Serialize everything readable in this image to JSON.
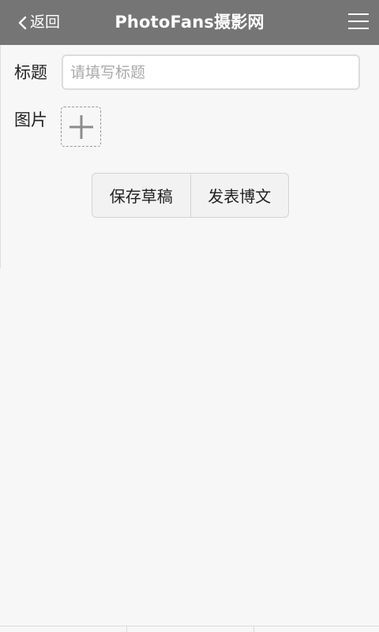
{
  "header": {
    "back_label": "返回",
    "title": "PhotoFans摄影网",
    "background_color": "#757575"
  },
  "form": {
    "title_label": "标题",
    "title_value": "",
    "title_placeholder": "请填写标题",
    "image_label": "图片"
  },
  "actions": {
    "save_draft_label": "保存草稿",
    "publish_label": "发表博文"
  },
  "icons": {
    "back": "chevron-left-icon",
    "menu": "hamburger-menu-icon",
    "add": "plus-icon"
  }
}
